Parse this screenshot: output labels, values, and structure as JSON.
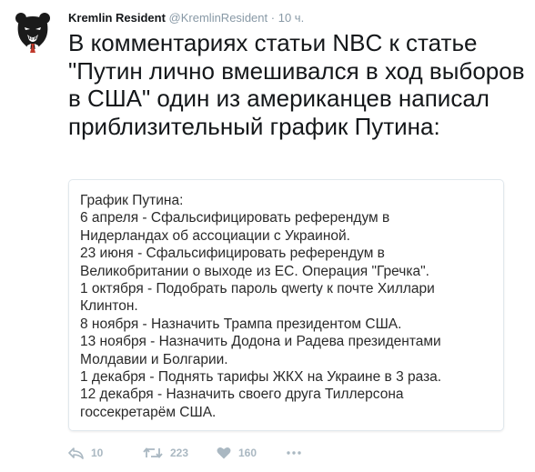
{
  "tweet": {
    "author_name": "Kremlin Resident",
    "author_handle": "@KremlinResident",
    "separator": "·",
    "timestamp": "10 ч.",
    "text": "В комментариях статьи NBC к статье \"Путин лично вмешивался в ход выборов в США\" один из американцев написал приблизительный график Путина:",
    "card_lines": [
      "График Путина:",
      "6 апреля - Сфальсифицировать референдум в",
      "Нидерландах об ассоциации с Украиной.",
      "23 июня - Сфальсифицировать референдум в",
      "Великобритании о выходе из ЕС. Операция \"Гречка\".",
      "1 октября - Подобрать пароль qwerty к почте Хиллари",
      "Клинтон.",
      "8 ноября - Назначить Трампа президентом США.",
      "13 ноября - Назначить Додона и Радева президентами",
      "Молдавии и Болгарии.",
      "1 декабря - Поднять тарифы ЖКХ на Украине в 3 раза.",
      "12 декабря - Назначить своего друга Тиллерсона",
      "госсекретарём США."
    ]
  },
  "actions": {
    "reply_count": "10",
    "retweet_count": "223",
    "like_count": "160",
    "icons": {
      "reply": "reply-icon",
      "retweet": "retweet-icon",
      "like": "heart-icon",
      "more": "more-dots-icon"
    }
  },
  "colors": {
    "text": "#14171a",
    "secondary": "#8899a6",
    "action_gray": "#aab8c2",
    "card_border": "#e1e8ed"
  }
}
